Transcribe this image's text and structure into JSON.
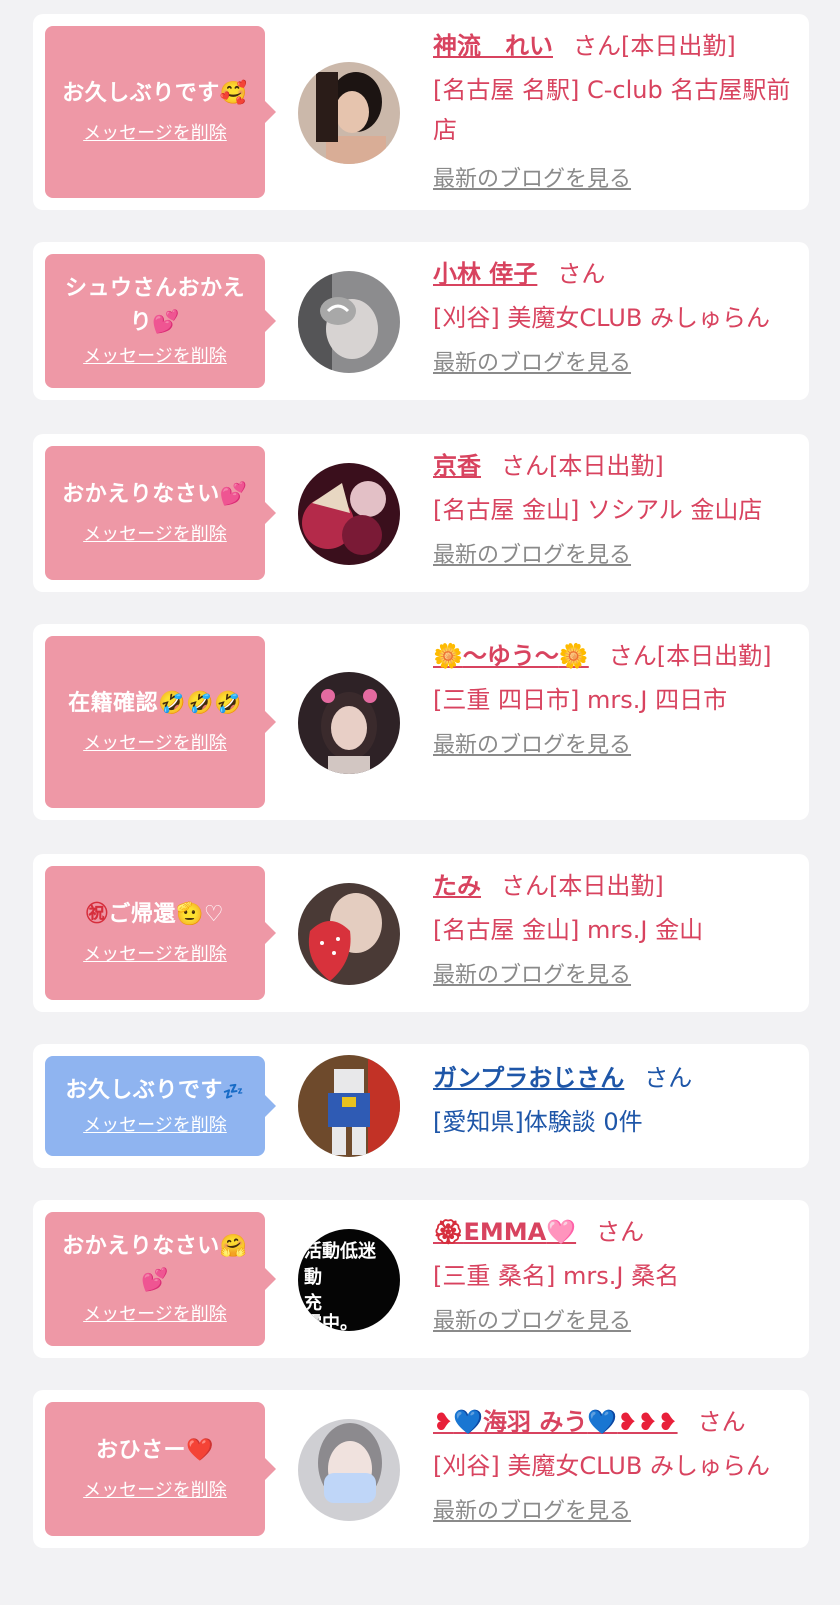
{
  "colors": {
    "accent_pink": "#ee98a6",
    "accent_blue": "#8fb4f0",
    "text_pink": "#d8435f",
    "text_blue": "#1e56a8",
    "link_gray": "#8a8a8a",
    "background": "#f2f2f4"
  },
  "delete_label": "メッセージを削除",
  "san_suffix": "さん",
  "blog_label": "最新のブログを見る",
  "cards": [
    {
      "message": "お久しぶりです",
      "message_icon": "smiling-face-with-hearts-icon",
      "name": "神流　れい",
      "status": "[本日出勤]",
      "shop": "[名古屋 名駅] C-club 名古屋駅前店"
    },
    {
      "message": "シュウさんおかえり",
      "message_icon": "heart-icon",
      "name": "小林 倖子",
      "status": "",
      "shop": "[刈谷] 美魔女CLUB みしゅらん"
    },
    {
      "message": "おかえりなさい",
      "message_icon": "heart-icon",
      "name": "京香",
      "status": "[本日出勤]",
      "shop": "[名古屋 金山] ソシアル 金山店"
    },
    {
      "message": "在籍確認",
      "message_icon": "rolling-laugh-icon",
      "name": "〜ゆう〜",
      "name_icon": "sunflower-icon",
      "status": "[本日出勤]",
      "shop": "[三重 四日市] mrs.J 四日市"
    },
    {
      "message": "ご帰還",
      "message_icon": "salute-face-icon",
      "name": "たみ",
      "status": "[本日出勤]",
      "shop": "[名古屋 金山] mrs.J 金山"
    },
    {
      "message": "お久しぶりです",
      "message_icon": "sparkle-icon",
      "name": "ガンプラおじさん",
      "status": "",
      "shop": "[愛知県]体験談 0件"
    },
    {
      "message": "おかえりなさい",
      "message_icon": "hugging-face-icon",
      "name": "EMMA",
      "name_icon": "rose-icon",
      "status": "",
      "shop": "[三重 桑名] mrs.J 桑名"
    },
    {
      "message": "おひさー",
      "message_icon": "heart-icon",
      "name": "海羽 みう",
      "name_icon": "blue-heart-icon",
      "status": "",
      "shop": "[刈谷] 美魔女CLUB みしゅらん"
    }
  ]
}
